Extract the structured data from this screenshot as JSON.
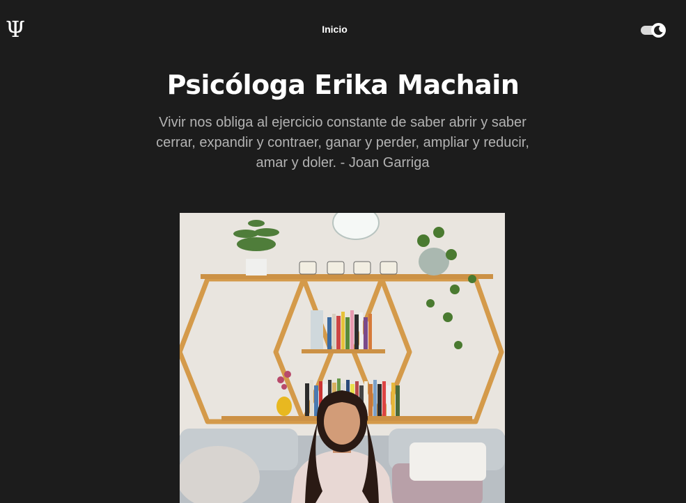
{
  "nav": {
    "logo_glyph": "Ψ",
    "links": [
      {
        "label": "Inicio"
      }
    ],
    "theme_toggle": {
      "state": "dark"
    }
  },
  "hero": {
    "title": "Psicóloga Erika Machain",
    "quote": "Vivir nos obliga al ejercicio constante de saber abrir y saber cerrar, expandir y contraer, ganar y perder, ampliar y reducir, amar y doler. - Joan Garriga"
  },
  "colors": {
    "background": "#1c1c1c",
    "text": "#ffffff",
    "quote_text": "#b3b3b3",
    "shelf_wood": "#d49a4a"
  }
}
